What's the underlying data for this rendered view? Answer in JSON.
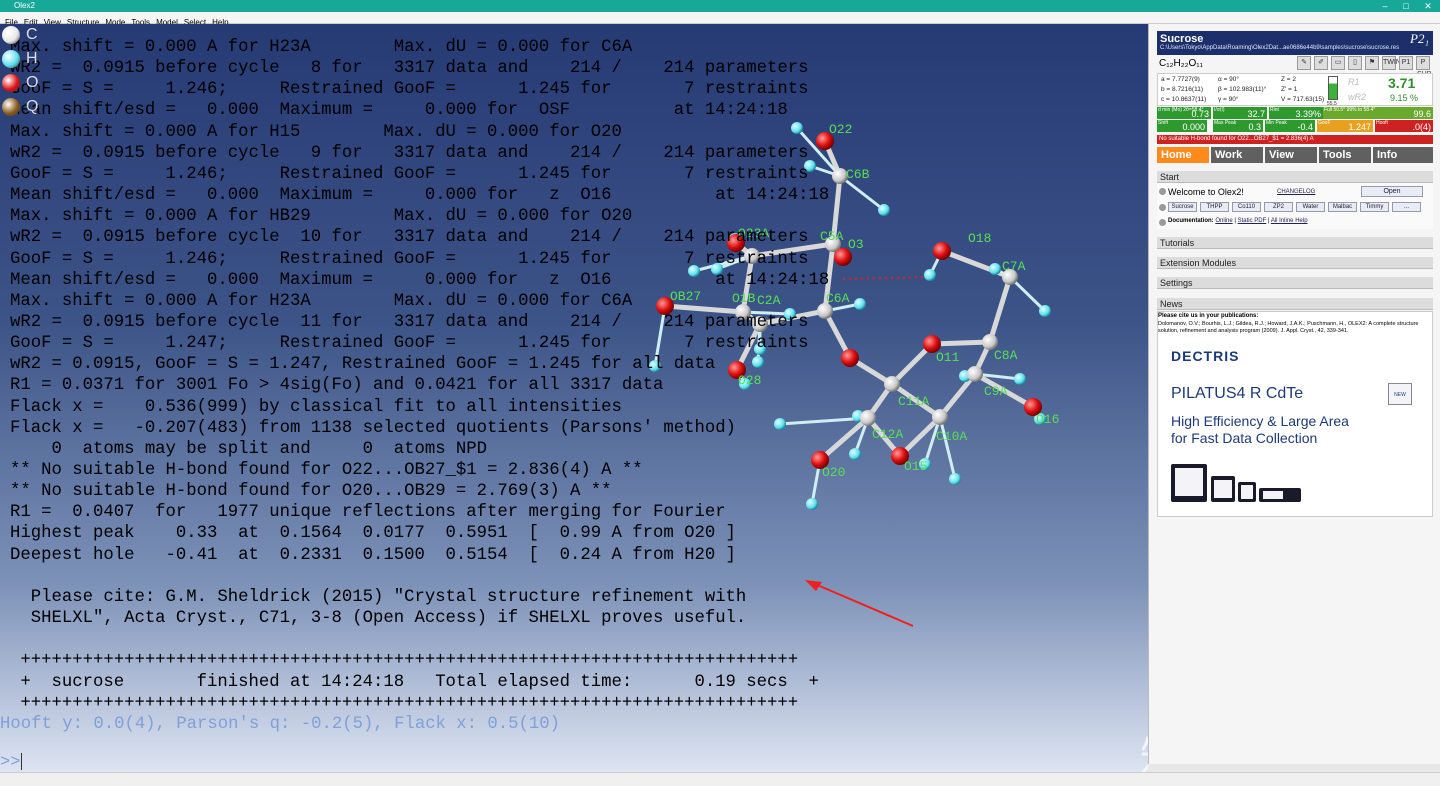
{
  "window": {
    "title": "Olex2"
  },
  "menu": [
    "File",
    "Edit",
    "View",
    "Structure",
    "Mode",
    "Tools",
    "Model",
    "Select",
    "Help"
  ],
  "elements": [
    {
      "symbol": "C",
      "color": "#e8e8e8"
    },
    {
      "symbol": "H",
      "color": "#5fe0ec"
    },
    {
      "symbol": "O",
      "color": "#e01010"
    },
    {
      "symbol": "Q",
      "color": "#8a5a1a"
    }
  ],
  "console_lines": [
    "Max. shift = 0.000 A for H23A        Max. dU = 0.000 for C6A",
    "wR2 =  0.0915 before cycle   8 for   3317 data and    214 /    214 parameters",
    "GooF = S =     1.246;     Restrained GooF =      1.245 for       7 restraints",
    "Mean shift/esd =   0.000  Maximum =     0.000 for  OSF          at 14:24:18",
    "Max. shift = 0.000 A for H15        Max. dU = 0.000 for O20",
    "wR2 =  0.0915 before cycle   9 for   3317 data and    214 /    214 parameters",
    "GooF = S =     1.246;     Restrained GooF =      1.245 for       7 restraints",
    "Mean shift/esd =   0.000  Maximum =     0.000 for   z  O16          at 14:24:18",
    "Max. shift = 0.000 A for HB29        Max. dU = 0.000 for O20",
    "wR2 =  0.0915 before cycle  10 for   3317 data and    214 /    214 parameters",
    "GooF = S =     1.246;     Restrained GooF =      1.245 for       7 restraints",
    "Mean shift/esd =   0.000  Maximum =     0.000 for   z  O16          at 14:24:18",
    "Max. shift = 0.000 A for H23A        Max. dU = 0.000 for C6A",
    "wR2 =  0.0915 before cycle  11 for   3317 data and    214 /    214 parameters",
    "GooF = S =     1.247;     Restrained GooF =      1.245 for       7 restraints",
    "wR2 = 0.0915, GooF = S = 1.247, Restrained GooF = 1.245 for all data",
    "R1 = 0.0371 for 3001 Fo > 4sig(Fo) and 0.0421 for all 3317 data",
    "Flack x =    0.536(999) by classical fit to all intensities",
    "Flack x =   -0.207(483) from 1138 selected quotients (Parsons' method)",
    "    0  atoms may be split and     0  atoms NPD",
    "** No suitable H-bond found for O22...OB27_$1 = 2.836(4) A **",
    "** No suitable H-bond found for O20...OB29 = 2.769(3) A **",
    "R1 =  0.0407  for   1977 unique reflections after merging for Fourier",
    "Highest peak    0.33  at  0.1564  0.0177  0.5951  [  0.99 A from O20 ]",
    "Deepest hole   -0.41  at  0.2331  0.1500  0.5154  [  0.24 A from H20 ]",
    "",
    "  Please cite: G.M. Sheldrick (2015) \"Crystal structure refinement with",
    "  SHELXL\", Acta Cryst., C71, 3-8 (Open Access) if SHELXL proves useful.",
    "",
    " +++++++++++++++++++++++++++++++++++++++++++++++++++++++++++++++++++++++++++",
    " +  sucrose       finished at 14:24:18   Total elapsed time:      0.19 secs  +",
    " +++++++++++++++++++++++++++++++++++++++++++++++++++++++++++++++++++++++++++"
  ],
  "hooft_line": "Hooft y: 0.0(4), Parson's q: -0.2(5), Flack x: 0.5(10)",
  "prompt": ">>",
  "atom_labels": [
    "O22",
    "C6B",
    "O23A",
    "C5A",
    "O3",
    "O18",
    "C7A",
    "OB27",
    "O1B",
    "C2A",
    "C6A",
    "O28",
    "O11",
    "C8A",
    "C11A",
    "C9A",
    "O16",
    "C12A",
    "C10A",
    "O15",
    "O20"
  ],
  "watermark": "知乎 @Tokyo",
  "panel": {
    "structure_name": "Sucrose",
    "space_group": "P2₁",
    "path": "C:\\Users\\Tokyo\\AppData\\Roaming\\Olex2Dat...ae0686e44b9\\samples\\sucrose\\sucrose.res",
    "formula": "C₁₂H₂₂O₁₁",
    "toolbar_icons": [
      "wrench-icon",
      "pencil-icon",
      "folder-icon",
      "document-icon",
      "flag-icon",
      "TWINS",
      "P1",
      "P SUB",
      "gear-icon"
    ],
    "cell": {
      "a": "a = 7.7727(9)",
      "b": "b = 8.7216(11)",
      "c": "c = 10.8637(11)",
      "alpha": "α = 90°",
      "beta": "β = 102.983(11)°",
      "gamma": "γ = 90°",
      "Z": "Z = 2",
      "Zp": "Z' = 1",
      "V": "V = 717.63(15)",
      "batt": "55.5"
    },
    "r1_label": "R1",
    "wr2_label": "wR2",
    "r1": "3.71",
    "wr2": "9.15 %",
    "stats": [
      {
        "label": "d min (Mo) 2θ=58.4°",
        "value": "0.73",
        "color": "#2e9a2e"
      },
      {
        "label": "I/σ(I)",
        "value": "32.7",
        "color": "#2e9a2e"
      },
      {
        "label": "Rint",
        "value": "3.39%",
        "color": "#2e9a2e"
      },
      {
        "label": "Full 50.5° 99% to 58.4°",
        "value": "99.6",
        "color": "#6aa82e"
      },
      {
        "label": "Shift",
        "value": "0.000",
        "color": "#2e9a2e"
      },
      {
        "label": "Max Peak",
        "value": "0.3",
        "color": "#2e9a2e"
      },
      {
        "label": "Min Peak",
        "value": "-0.4",
        "color": "#2e9a2e"
      },
      {
        "label": "GooF",
        "value": "1.247",
        "color": "#e8a020"
      },
      {
        "label": "Hooft",
        "value": ".0(4)",
        "color": "#cc2222"
      }
    ],
    "hbond_warning": "No suitable H-bond found for O22...OB27_$1 = 2.836(4) A",
    "tabs": [
      "Home",
      "Work",
      "View",
      "Tools",
      "Info"
    ],
    "start_label": "Start",
    "welcome": "Welcome to Olex2!",
    "changelog": "CHANGELOG",
    "open": "Open",
    "samples": [
      "Sucrose",
      "THPP",
      "Co110",
      "ZP2",
      "Water",
      "Malbac",
      "Timmy",
      "..."
    ],
    "doc_label": "Documentation:",
    "doc_links": [
      "Online",
      "Static PDF",
      "All Inline Help"
    ],
    "sections": [
      "Tutorials",
      "Extension Modules",
      "Settings"
    ],
    "news_label": "News",
    "news_cite_title": "Please cite us in your publications:",
    "news_cite_text": "Dolomanov, O.V.; Bourhis, L.J.; Gildea, R.J.; Howard, J.A.K.; Puschmann, H., OLEX2: A complete structure solution, refinement and analysis program (2009). J. Appl. Cryst., 42, 339-341.",
    "ad_brand": "DECTRIS",
    "ad_product": "PILATUS4 R CdTe",
    "ad_line1": "High Efficiency & Large Area",
    "ad_line2": "for Fast Data Collection",
    "ad_badge": "NEW"
  }
}
